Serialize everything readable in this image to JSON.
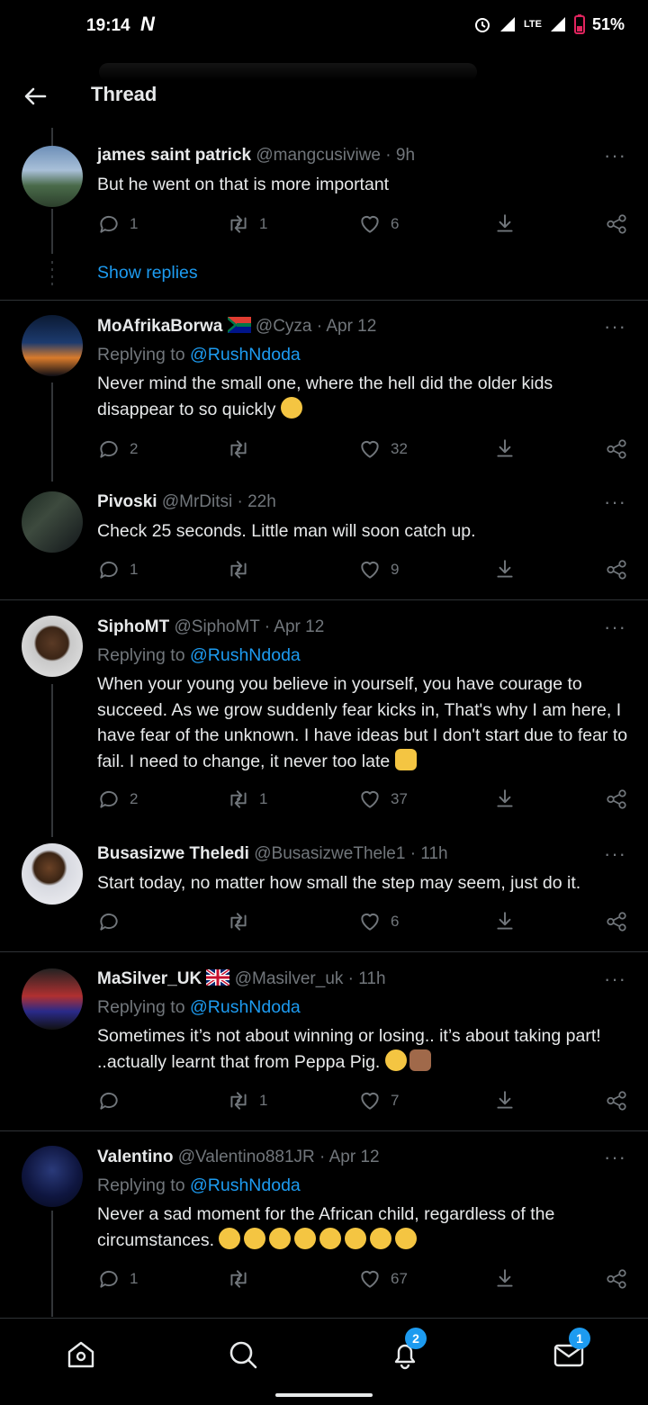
{
  "status": {
    "time": "19:14",
    "network": "LTE",
    "battery": "51%"
  },
  "header": {
    "title": "Thread"
  },
  "common": {
    "show_replies": "Show replies",
    "replying_prefix": "Replying to "
  },
  "tweets": [
    {
      "name": "james saint patrick",
      "handle": "@mangcusiviwe · 9h",
      "text": "But he went on that is more important",
      "replies": "1",
      "retweets": "1",
      "likes": "6"
    },
    {
      "name": "MoAfrikaBorwa",
      "handle": "@Cyza · Apr 12",
      "reply_to": "@RushNdoda",
      "text": "Never mind the small one, where the hell did the older kids disappear to so quickly",
      "replies": "2",
      "retweets": "",
      "likes": "32"
    },
    {
      "name": "Pivoski",
      "handle": "@MrDitsi · 22h",
      "text": "Check 25 seconds. Little man will soon catch up.",
      "replies": "1",
      "retweets": "",
      "likes": "9"
    },
    {
      "name": "SiphoMT",
      "handle": "@SiphoMT · Apr 12",
      "reply_to": "@RushNdoda",
      "text": "When your young you believe in yourself, you have courage to succeed. As we grow suddenly fear kicks in, That's why I am here, I have fear of the unknown. I have ideas but I don't start due to fear to fail. I need to change, it never too late",
      "replies": "2",
      "retweets": "1",
      "likes": "37"
    },
    {
      "name": "Busasizwe Theledi",
      "handle": "@BusasizweThele1 · 11h",
      "text": "Start today, no matter how small the step may seem, just do it.",
      "replies": "",
      "retweets": "",
      "likes": "6"
    },
    {
      "name": "MaSilver_UK",
      "handle": "@Masilver_uk · 11h",
      "reply_to": "@RushNdoda",
      "text": "Sometimes it’s not about winning or losing.. it’s about taking part! ..actually learnt that from Peppa Pig.",
      "replies": "",
      "retweets": "1",
      "likes": "7"
    },
    {
      "name": "Valentino",
      "handle": "@Valentino881JR · Apr 12",
      "reply_to": "@RushNdoda",
      "text": "Never a sad moment for the African child,  regardless of the circumstances.",
      "replies": "1",
      "retweets": "",
      "likes": "67"
    }
  ],
  "bottom_nav": {
    "notifications_badge": "2",
    "messages_badge": "1"
  },
  "colors": {
    "accent": "#1d9bf0",
    "muted": "#71767b",
    "background": "#000000"
  }
}
